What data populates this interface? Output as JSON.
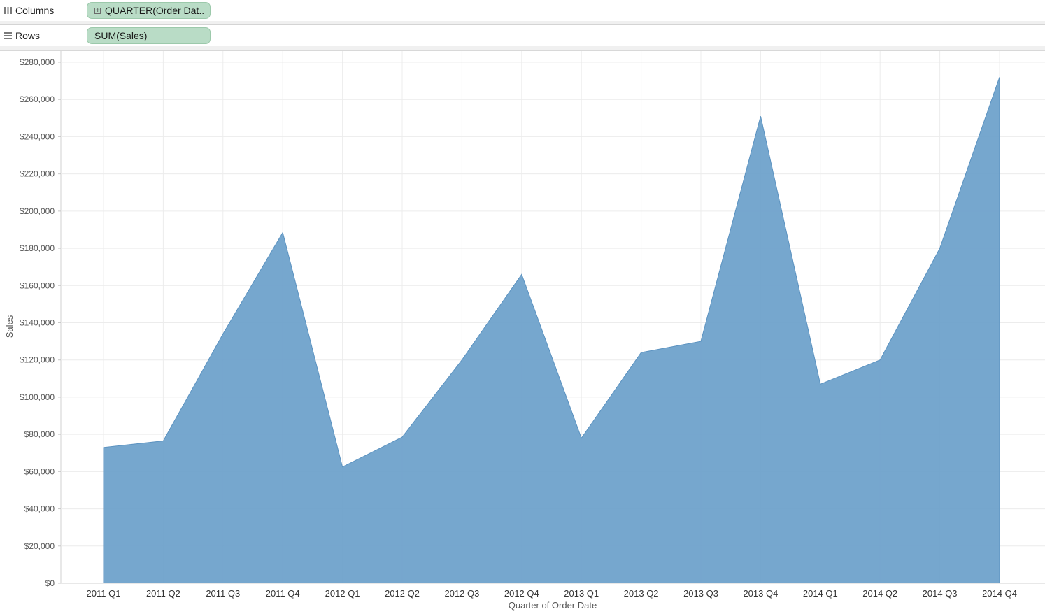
{
  "shelves": {
    "columns": {
      "label": "Columns",
      "pill": "QUARTER(Order Dat..",
      "icon": "columns-icon"
    },
    "rows": {
      "label": "Rows",
      "pill": "SUM(Sales)",
      "icon": "rows-icon"
    }
  },
  "colors": {
    "area": "#6a9fca",
    "pill": "#b9dcc6"
  },
  "chart_data": {
    "type": "area",
    "xlabel": "Quarter of Order Date",
    "ylabel": "Sales",
    "categories": [
      "2011 Q1",
      "2011 Q2",
      "2011 Q3",
      "2011 Q4",
      "2012 Q1",
      "2012 Q2",
      "2012 Q3",
      "2012 Q4",
      "2013 Q1",
      "2013 Q2",
      "2013 Q3",
      "2013 Q4",
      "2014 Q1",
      "2014 Q2",
      "2014 Q3",
      "2014 Q4"
    ],
    "values": [
      73000,
      76500,
      134000,
      188500,
      62500,
      78500,
      120000,
      166000,
      78000,
      124000,
      130000,
      251000,
      107000,
      120000,
      180000,
      272000
    ],
    "ylim": [
      0,
      280000
    ],
    "yticks": [
      "$0",
      "$20,000",
      "$40,000",
      "$60,000",
      "$80,000",
      "$100,000",
      "$120,000",
      "$140,000",
      "$160,000",
      "$180,000",
      "$200,000",
      "$220,000",
      "$240,000",
      "$260,000",
      "$280,000"
    ],
    "grid": true
  }
}
